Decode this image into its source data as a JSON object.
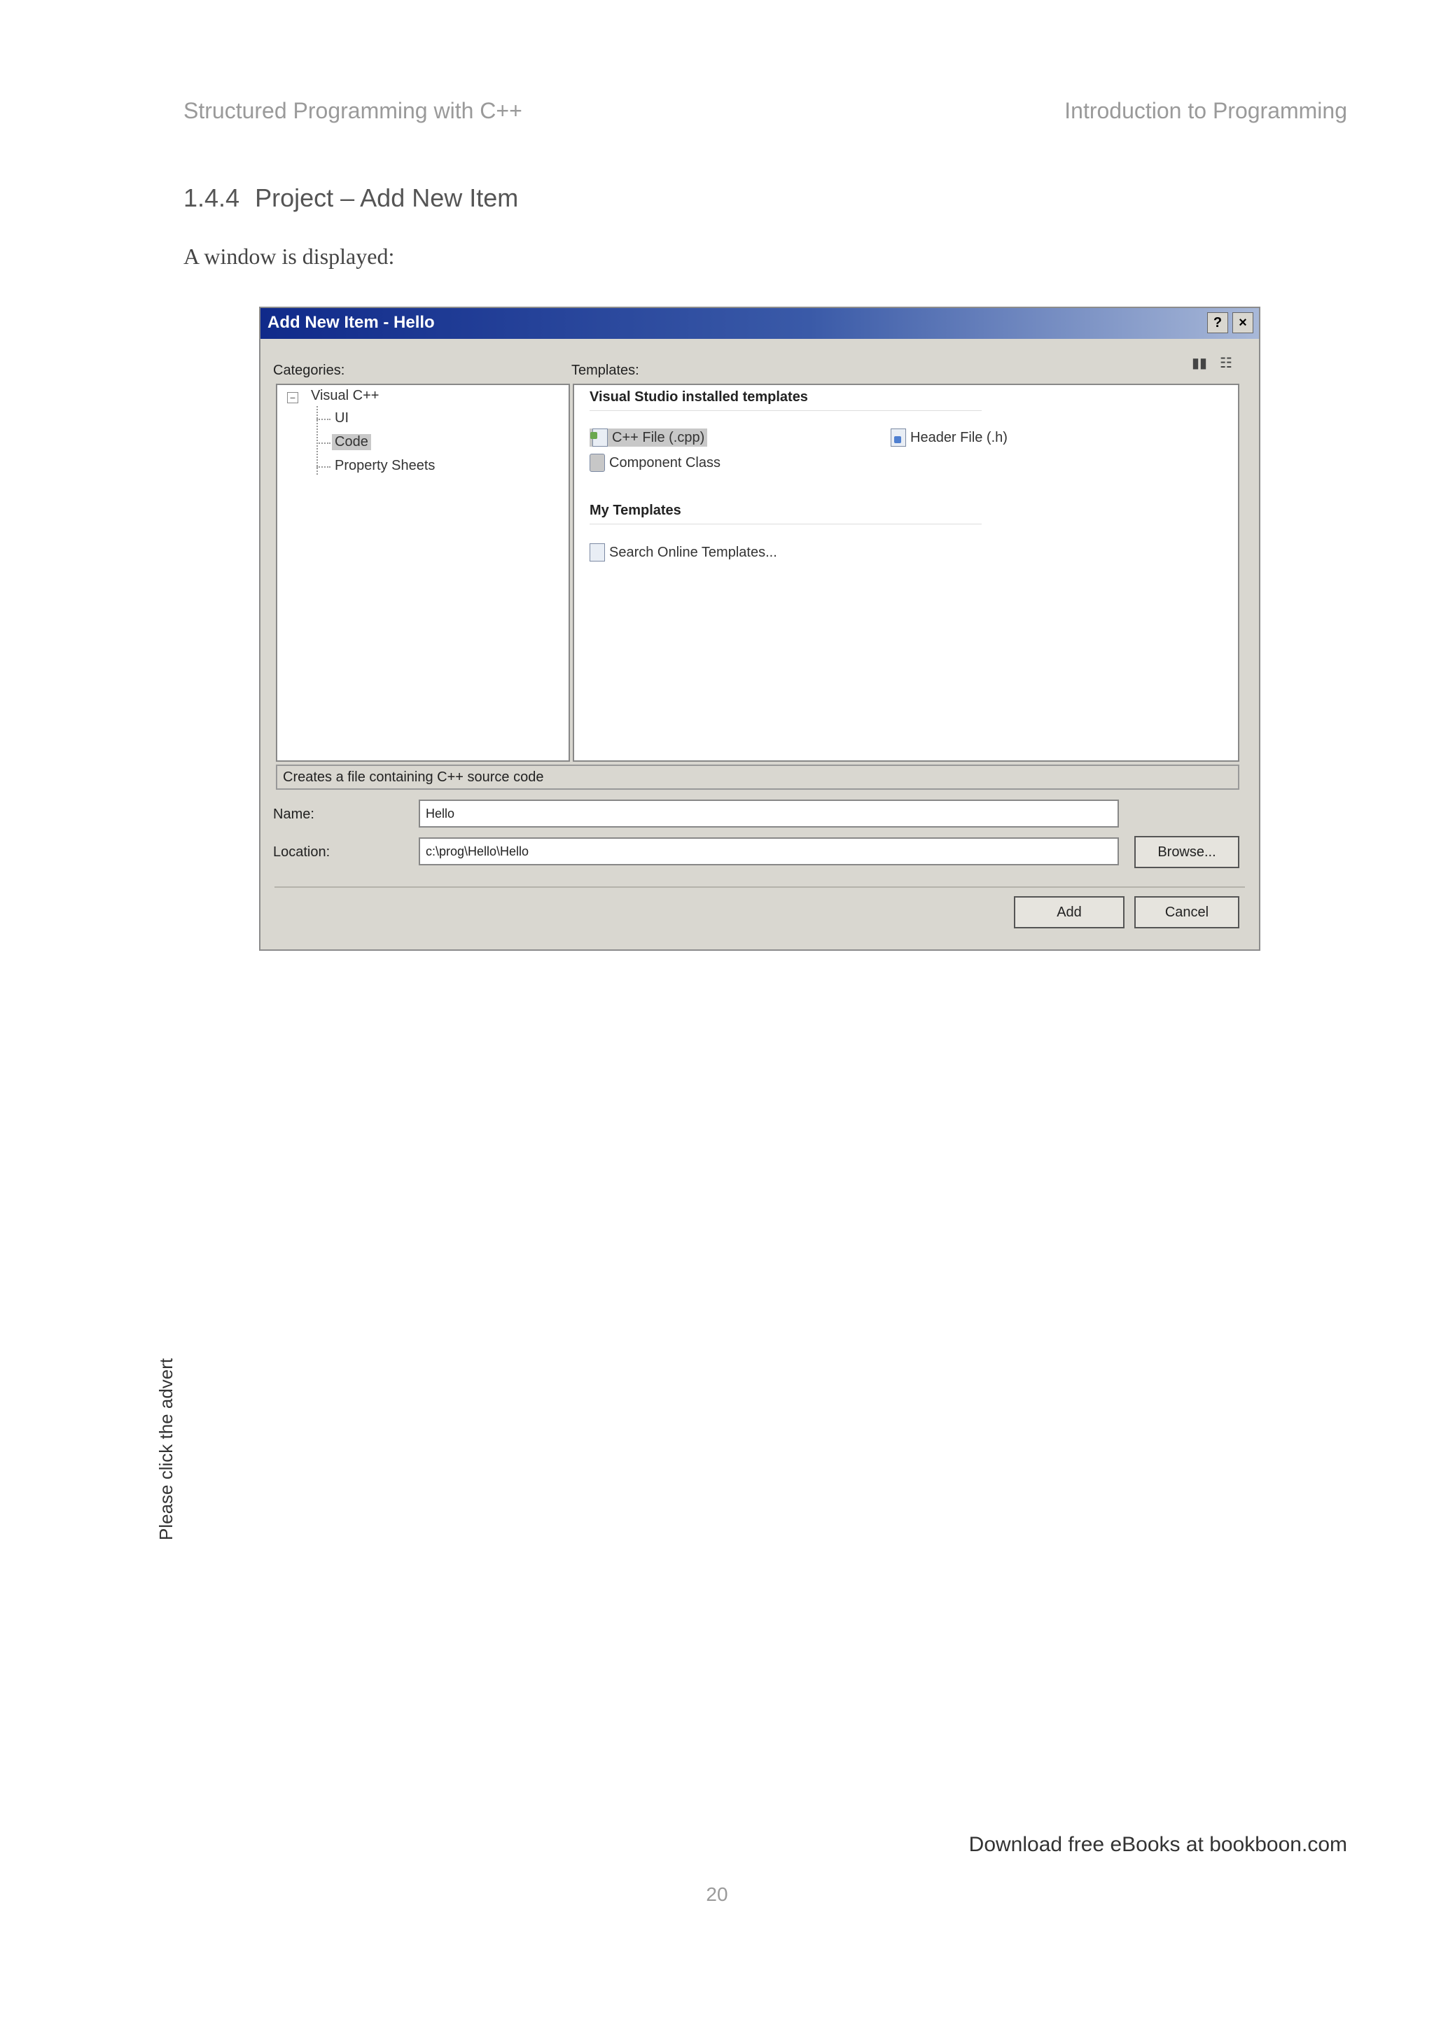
{
  "header": {
    "left": "Structured Programming with C++",
    "right": "Introduction to Programming"
  },
  "section": {
    "number": "1.4.4",
    "title": "Project – Add New Item"
  },
  "body_text": "A window is displayed:",
  "dialog": {
    "title": "Add New Item - Hello",
    "help_btn": "?",
    "close_btn": "×",
    "categories_label": "Categories:",
    "templates_label": "Templates:",
    "view_btn_large": "▮▮",
    "view_btn_small": "☷",
    "tree": {
      "root": "Visual C++",
      "expander": "−",
      "children": [
        "UI",
        "Code",
        "Property Sheets"
      ],
      "selected": "Code"
    },
    "groups": {
      "installed": "Visual Studio installed templates",
      "my": "My Templates"
    },
    "templates": {
      "cpp_file": "C++ File (.cpp)",
      "header_file": "Header File (.h)",
      "component_class": "Component Class",
      "search_online": "Search Online Templates..."
    },
    "description": "Creates a file containing C++ source code",
    "name_label": "Name:",
    "name_value": "Hello",
    "location_label": "Location:",
    "location_value": "c:\\prog\\Hello\\Hello",
    "browse_label": "Browse...",
    "add_label": "Add",
    "cancel_label": "Cancel"
  },
  "side_note": "Please click the advert",
  "footer": {
    "link": "Download free eBooks at bookboon.com",
    "page_number": "20"
  }
}
